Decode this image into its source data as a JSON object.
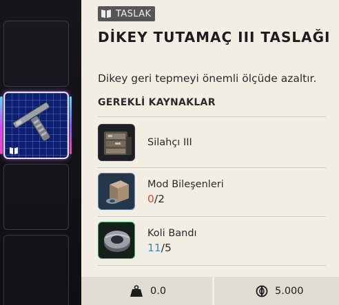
{
  "blueprint": {
    "badge_label": "TASLAK",
    "title": "DİKEY TUTAMAÇ III TASLAĞI",
    "description": "Dikey geri tepmeyi önemli ölçüde azaltır.",
    "requirements_heading": "GEREKLİ KAYNAKLAR"
  },
  "resources": [
    {
      "name": "Silahçı III",
      "icon": "workbench-icon"
    },
    {
      "name": "Mod Bileşenleri",
      "have": "0",
      "need": "/2",
      "have_color": "#e0472f",
      "icon": "mod-components-icon"
    },
    {
      "name": "Koli Bandı",
      "have": "11",
      "need": "/5",
      "have_color": "#3f86b8",
      "icon": "duct-tape-icon"
    }
  ],
  "footer": {
    "weight": "0.0",
    "weight_icon": "weight-icon",
    "price": "5.000",
    "price_icon": "coin-icon"
  },
  "inventory": {
    "selected_item_icon": "vertical-grip-icon",
    "slot_badge_icon": "book-icon"
  },
  "colors": {
    "panel_bg": "#f3eee3",
    "badge_bg": "#565658",
    "selected_slot_bg": "#0d1e6e",
    "missing": "#e0472f",
    "sufficient": "#3f86b8"
  }
}
